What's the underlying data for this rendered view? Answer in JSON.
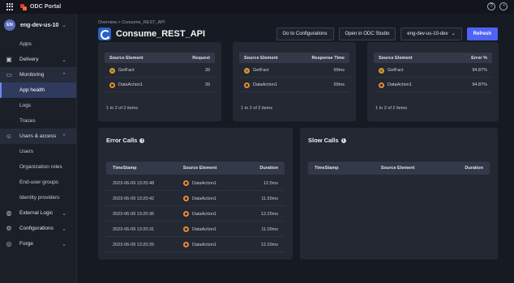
{
  "topbar": {
    "brand": "ODC Portal",
    "help_icon": "help-circle-icon",
    "user_icon": "user-circle-icon"
  },
  "sidebar": {
    "tenant": {
      "initials": "EN",
      "name": "eng-dev-us-10"
    },
    "items": [
      {
        "type": "sub",
        "label": "Apps"
      },
      {
        "type": "main",
        "label": "Delivery",
        "icon": "box-icon"
      },
      {
        "type": "main",
        "label": "Monitoring",
        "icon": "monitor-icon",
        "open": true
      },
      {
        "type": "sub",
        "label": "App health",
        "active": true
      },
      {
        "type": "sub",
        "label": "Logs"
      },
      {
        "type": "sub",
        "label": "Traces"
      },
      {
        "type": "main",
        "label": "Users & access",
        "icon": "users-icon",
        "open": true
      },
      {
        "type": "sub",
        "label": "Users"
      },
      {
        "type": "sub",
        "label": "Organization roles"
      },
      {
        "type": "sub",
        "label": "End-user groups"
      },
      {
        "type": "sub",
        "label": "Identity providers"
      },
      {
        "type": "main",
        "label": "External Logic",
        "icon": "globe-icon"
      },
      {
        "type": "main",
        "label": "Configurations",
        "icon": "gear-icon"
      },
      {
        "type": "main",
        "label": "Forge",
        "icon": "forge-icon"
      }
    ]
  },
  "header": {
    "breadcrumb": "Overview  >  Consume_REST_API",
    "title": "Consume_REST_API",
    "go_to_config": "Go to Configurations",
    "open_studio": "Open in ODC Studio",
    "stage": "eng-dev-us-10-dev",
    "refresh": "Refresh"
  },
  "top_cards": [
    {
      "col1": "Source Element",
      "col2": "Request",
      "rows": [
        {
          "name": "GetFact",
          "kind": "gf",
          "value": "39"
        },
        {
          "name": "DataAction1",
          "kind": "da",
          "value": "39"
        }
      ],
      "pager": "1 to 2 of 2 items"
    },
    {
      "col1": "Source Element",
      "col2": "Response Time",
      "rows": [
        {
          "name": "GetFact",
          "kind": "gf",
          "value": "99ms"
        },
        {
          "name": "DataAction1",
          "kind": "da",
          "value": "99ms"
        }
      ],
      "pager": "1 to 2 of 2 items"
    },
    {
      "col1": "Source Element",
      "col2": "Error %",
      "rows": [
        {
          "name": "GetFact",
          "kind": "gf",
          "value": "94.87%"
        },
        {
          "name": "DataAction1",
          "kind": "da",
          "value": "94.87%"
        }
      ],
      "pager": "1 to 2 of 2 items"
    }
  ],
  "error_calls": {
    "title": "Error Calls",
    "columns": [
      "TimeStamp",
      "Source Element",
      "Duration"
    ],
    "rows": [
      {
        "timestamp": "2023-06-09 13:20:48",
        "element": "DataAction1",
        "duration": "12.5ms"
      },
      {
        "timestamp": "2023-06-09 13:20:42",
        "element": "DataAction1",
        "duration": "11.55ms"
      },
      {
        "timestamp": "2023-06-09 13:20:36",
        "element": "DataAction1",
        "duration": "12.25ms"
      },
      {
        "timestamp": "2023-06-09 13:20:31",
        "element": "DataAction1",
        "duration": "11.09ms"
      },
      {
        "timestamp": "2023-06-09 13:20:26",
        "element": "DataAction1",
        "duration": "12.29ms"
      }
    ]
  },
  "slow_calls": {
    "title": "Slow Calls",
    "columns": [
      "TimeStamp",
      "Source Element",
      "Duration"
    ]
  },
  "colors": {
    "accent": "#4f63f5",
    "active_nav": "#2f3a5e",
    "background": "#161a22",
    "card": "#232833"
  }
}
